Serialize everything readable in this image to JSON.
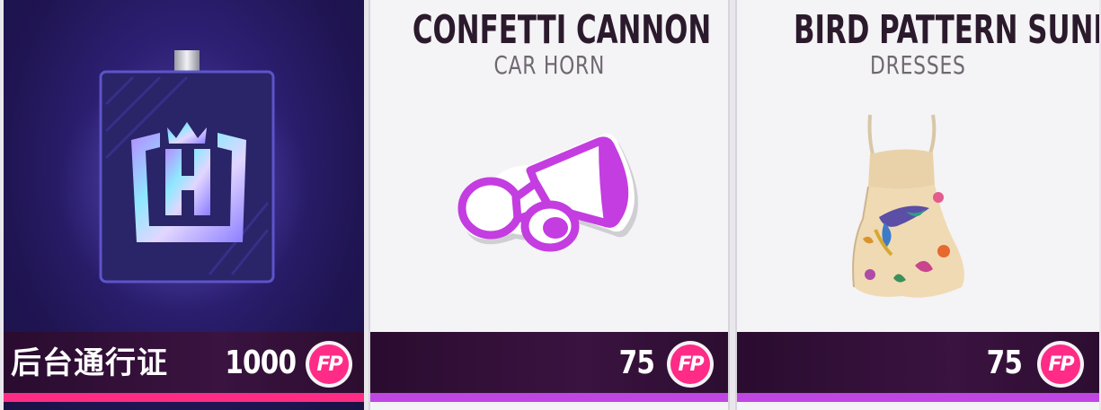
{
  "cards": [
    {
      "id": "backstage-pass",
      "name": "后台通行证",
      "price": "1000",
      "currency_icon": "fp-coin-icon",
      "item_icon": "backstage-pass-badge-icon"
    },
    {
      "id": "confetti-cannon",
      "name": "CONFETTI CANNON",
      "category": "CAR HORN",
      "price": "75",
      "currency_icon": "fp-coin-icon",
      "item_icon": "megaphone-icon"
    },
    {
      "id": "bird-pattern-sundress",
      "name": "BIRD PATTERN SUNDRESS",
      "category": "DRESSES",
      "price": "75",
      "currency_icon": "fp-coin-icon",
      "item_icon": "sundress-icon"
    }
  ],
  "currency_label": "FP",
  "colors": {
    "accent_pink": "#ff2b86",
    "accent_purple": "#c046e4",
    "footer_dark": "#2f0f34",
    "card_dark_bg": "#2a1c6a"
  }
}
